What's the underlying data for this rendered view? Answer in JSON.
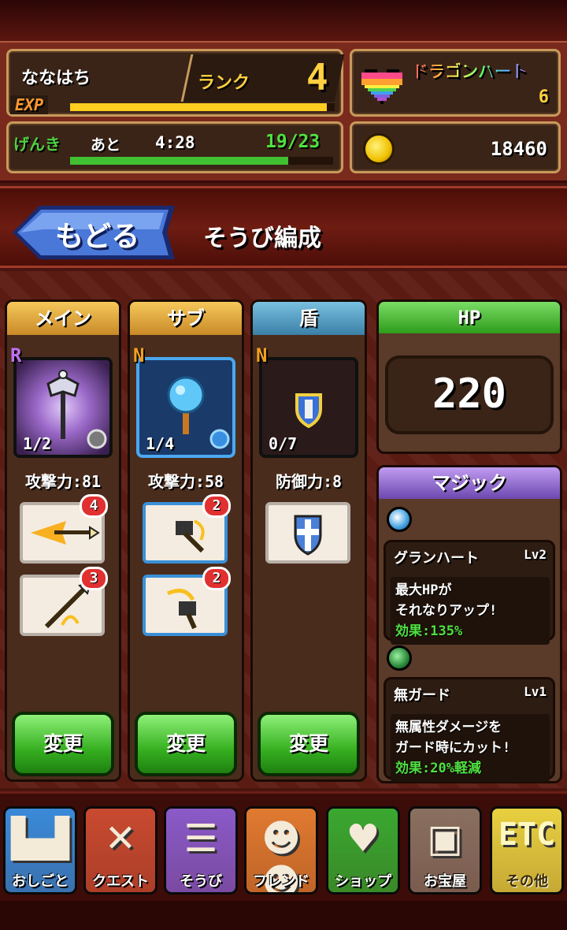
{
  "player": {
    "name": "ななはち",
    "rank_label": "ランク",
    "rank": "4",
    "exp_label": "EXP",
    "exp_progress": 0.97,
    "stamina_label": "げんき",
    "stamina_remaining_label": "あと",
    "stamina_timer": "4:28",
    "stamina_count": "19/23",
    "stamina_progress": 0.83
  },
  "currency": {
    "heart_label": "ドラゴンハート",
    "heart_count": "6",
    "gold_count": "18460"
  },
  "header": {
    "back_label": "もどる",
    "title": "そうび編成"
  },
  "columns": [
    {
      "title": "メイン",
      "rarity": "R",
      "level": "1/2",
      "stat": "攻撃力:81",
      "change_label": "変更",
      "skills": [
        {
          "badge": "4"
        },
        {
          "badge": "3"
        }
      ]
    },
    {
      "title": "サブ",
      "rarity": "N",
      "level": "1/4",
      "stat": "攻撃力:58",
      "change_label": "変更",
      "skills": [
        {
          "badge": "2"
        },
        {
          "badge": "2"
        }
      ]
    },
    {
      "title": "盾",
      "rarity": "N",
      "level": "0/7",
      "stat": "防御力:8",
      "change_label": "変更",
      "skills": []
    }
  ],
  "hp": {
    "label": "HP",
    "value": "220"
  },
  "magic": {
    "title": "マジック",
    "items": [
      {
        "name": "グランハート",
        "level": "Lv2",
        "desc1": "最大HPが",
        "desc2": "それなりアップ!",
        "effect": "効果:135%"
      },
      {
        "name": "無ガード",
        "level": "Lv1",
        "desc1": "無属性ダメージを",
        "desc2": "ガード時にカット!",
        "effect": "効果:20%軽減"
      }
    ]
  },
  "nav": [
    {
      "label": "おしごと",
      "icon": "castle-icon",
      "color": "#3a8ad8"
    },
    {
      "label": "クエスト",
      "icon": "swords-icon",
      "color": "#c84a30"
    },
    {
      "label": "そうび",
      "icon": "list-icon",
      "color": "#8a5ac8"
    },
    {
      "label": "フレンド",
      "icon": "friends-icon",
      "color": "#e07a30"
    },
    {
      "label": "ショップ",
      "icon": "heart-icon",
      "color": "#3aa830"
    },
    {
      "label": "お宝屋",
      "icon": "chest-icon",
      "color": "#8a7060"
    },
    {
      "label": "その他",
      "icon": "etc-icon",
      "color": "#e8d040",
      "glyph": "ETC"
    }
  ]
}
